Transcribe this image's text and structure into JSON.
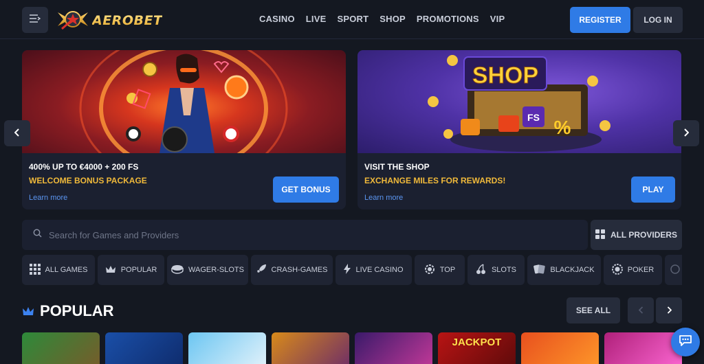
{
  "header": {
    "logo_text": "AEROBET",
    "nav": [
      "CASINO",
      "LIVE",
      "SPORT",
      "SHOP",
      "PROMOTIONS",
      "VIP"
    ],
    "register_label": "REGISTER",
    "login_label": "LOG IN"
  },
  "banners": [
    {
      "title": "400% UP TO €4000 + 200 FS",
      "subtitle": "WELCOME BONUS PACKAGE",
      "link": "Learn more",
      "button": "GET BONUS"
    },
    {
      "title": "VISIT THE SHOP",
      "subtitle": "EXCHANGE MILES FOR REWARDS!",
      "link": "Learn more",
      "button": "PLAY",
      "image_text": "SHOP",
      "image_badge": "FS"
    }
  ],
  "search": {
    "placeholder": "Search for Games and Providers",
    "providers_label": "ALL PROVIDERS"
  },
  "categories": [
    {
      "label": "ALL GAMES",
      "icon": "grid-icon"
    },
    {
      "label": "POPULAR",
      "icon": "crown-icon"
    },
    {
      "label": "WAGER-SLOTS",
      "icon": "coins-icon"
    },
    {
      "label": "CRASH-GAMES",
      "icon": "rocket-icon"
    },
    {
      "label": "LIVE CASINO",
      "icon": "lightning-icon"
    },
    {
      "label": "TOP",
      "icon": "badge-icon"
    },
    {
      "label": "SLOTS",
      "icon": "cherries-icon"
    },
    {
      "label": "BLACKJACK",
      "icon": "cards-icon"
    },
    {
      "label": "POKER",
      "icon": "chip-icon"
    }
  ],
  "popular": {
    "title": "POPULAR",
    "see_all": "SEE ALL",
    "games": [
      {
        "colors": [
          "#2d8a3a",
          "#7a5a2a"
        ]
      },
      {
        "colors": [
          "#1a4fa8",
          "#0e2a6a"
        ]
      },
      {
        "colors": [
          "#6cc6f2",
          "#e8f4fb"
        ]
      },
      {
        "colors": [
          "#d88a1a",
          "#6a2a6a"
        ]
      },
      {
        "colors": [
          "#3a1a6a",
          "#c83a9a"
        ]
      },
      {
        "colors": [
          "#b81414",
          "#5a0a0a"
        ],
        "text": "JACKPOT"
      },
      {
        "colors": [
          "#e8501e",
          "#ff9a2a"
        ]
      },
      {
        "colors": [
          "#b0207a",
          "#ff6ad6"
        ]
      }
    ]
  }
}
